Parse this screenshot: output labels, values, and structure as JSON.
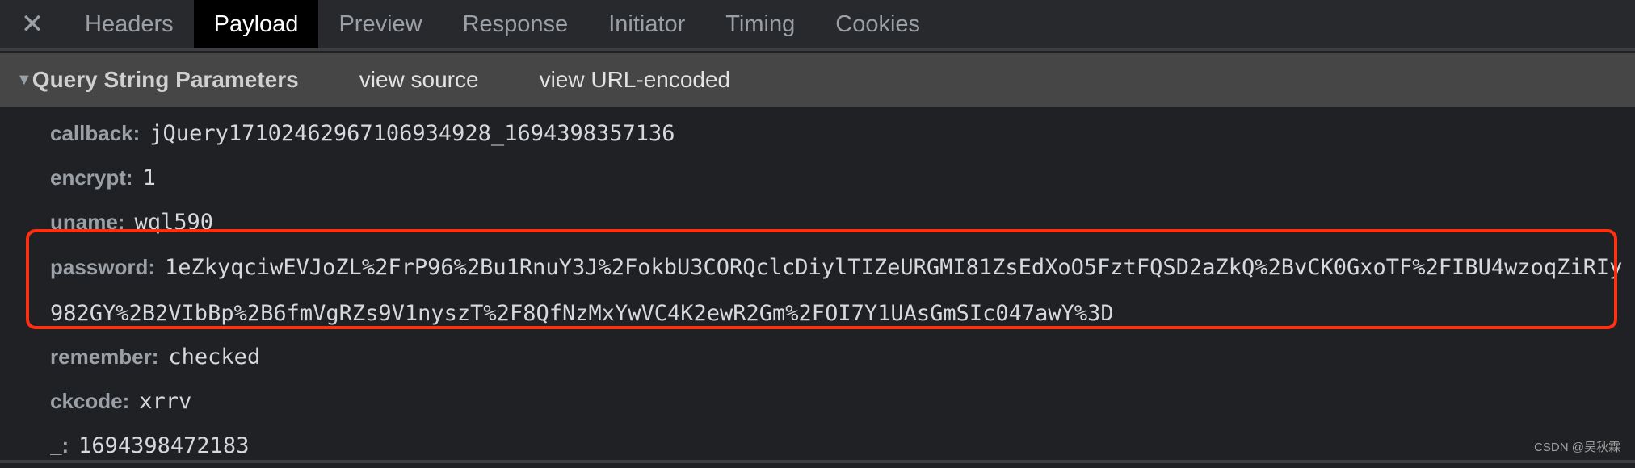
{
  "tabs": {
    "close_icon": "close-icon",
    "items": [
      {
        "label": "Headers"
      },
      {
        "label": "Payload",
        "active": true
      },
      {
        "label": "Preview"
      },
      {
        "label": "Response"
      },
      {
        "label": "Initiator"
      },
      {
        "label": "Timing"
      },
      {
        "label": "Cookies"
      }
    ]
  },
  "section": {
    "title": "Query String Parameters",
    "view_source": "view source",
    "view_url_encoded": "view URL-encoded",
    "expanded": true
  },
  "params": [
    {
      "key": "callback:",
      "value": "jQuery17102462967106934928_1694398357136"
    },
    {
      "key": "encrypt:",
      "value": "1"
    },
    {
      "key": "uname:",
      "value": "wql590"
    },
    {
      "key": "password:",
      "value": "1eZkyqciwEVJoZL%2FrP96%2Bu1RnuY3J%2FokbU3CORQclcDiylTIZeURGMI81ZsEdXoO5FztFQSD2aZkQ%2BvCK0GxoTF%2FIBU4wzoqZiRIy982GY%2B2VIbBp%2B6fmVgRZs9V1nyszT%2F8QfNzMxYwVC4K2ewR2Gm%2FOI7Y1UAsGmSIc047awY%3D"
    },
    {
      "key": "remember:",
      "value": "checked"
    },
    {
      "key": "ckcode:",
      "value": "xrrv"
    },
    {
      "key": "_:",
      "value": "1694398472183"
    }
  ],
  "highlight_color": "#ff3010",
  "watermark": "CSDN @吴秋霖"
}
